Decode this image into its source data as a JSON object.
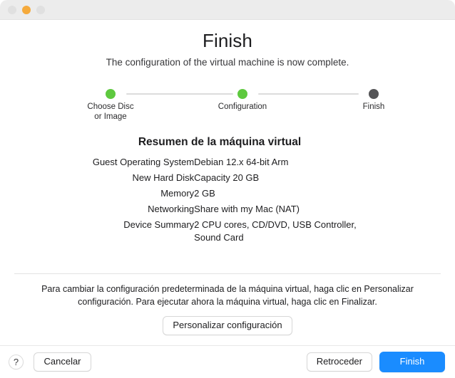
{
  "window": {
    "traffic_lights": [
      {
        "name": "close",
        "color": "#e0e0e0"
      },
      {
        "name": "minimize",
        "color": "#f5aa3c"
      },
      {
        "name": "zoom",
        "color": "#e0e0e0"
      }
    ]
  },
  "header": {
    "title": "Finish",
    "subtitle": "The configuration of the virtual machine is now complete."
  },
  "stepper": {
    "steps": [
      {
        "label": "Choose Disc\nor Image",
        "state": "complete",
        "color": "#5ec93f"
      },
      {
        "label": "Configuration",
        "state": "complete",
        "color": "#5ec93f"
      },
      {
        "label": "Finish",
        "state": "current",
        "color": "#555557"
      }
    ]
  },
  "summary": {
    "title": "Resumen de la máquina virtual",
    "rows": [
      {
        "label": "Guest Operating System",
        "value": "Debian 12.x 64-bit Arm"
      },
      {
        "label": "New Hard Disk",
        "value": "Capacity 20 GB"
      },
      {
        "label": "Memory",
        "value": "2 GB"
      },
      {
        "label": "Networking",
        "value": "Share with my Mac (NAT)"
      },
      {
        "label": "Device Summary",
        "value": "2 CPU cores, CD/DVD, USB Controller, Sound Card"
      }
    ]
  },
  "footer": {
    "note": "Para cambiar la configuración predeterminada de la máquina virtual, haga clic en Personalizar configuración. Para ejecutar ahora la máquina virtual, haga clic en Finalizar.",
    "customize_label": "Personalizar configuración"
  },
  "bottom_bar": {
    "help_label": "?",
    "cancel_label": "Cancelar",
    "back_label": "Retroceder",
    "finish_label": "Finish",
    "accent_color": "#1a8cff"
  }
}
